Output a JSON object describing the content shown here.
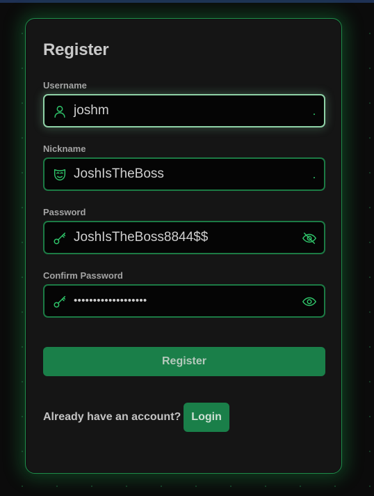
{
  "form": {
    "title": "Register",
    "fields": [
      {
        "label": "Username",
        "value": "joshm",
        "icon": "user-icon"
      },
      {
        "label": "Nickname",
        "value": "JoshIsTheBoss",
        "icon": "mask-icon"
      },
      {
        "label": "Password",
        "value": "JoshIsTheBoss8844$$",
        "icon": "key-icon",
        "toggle_icon": "eye-off-icon"
      },
      {
        "label": "Confirm Password",
        "value": "•••••••••••••••••••",
        "icon": "key-icon",
        "toggle_icon": "eye-icon"
      }
    ],
    "submit_label": "Register",
    "footer_text": "Already have an account?",
    "login_label": "Login"
  },
  "colors": {
    "accent": "#1a7f49",
    "border": "#1c7a44",
    "focus_border": "#8fd2a7",
    "icon": "#2fc56a",
    "card_bg": "#151515",
    "page_bg": "#0b0b0b"
  }
}
